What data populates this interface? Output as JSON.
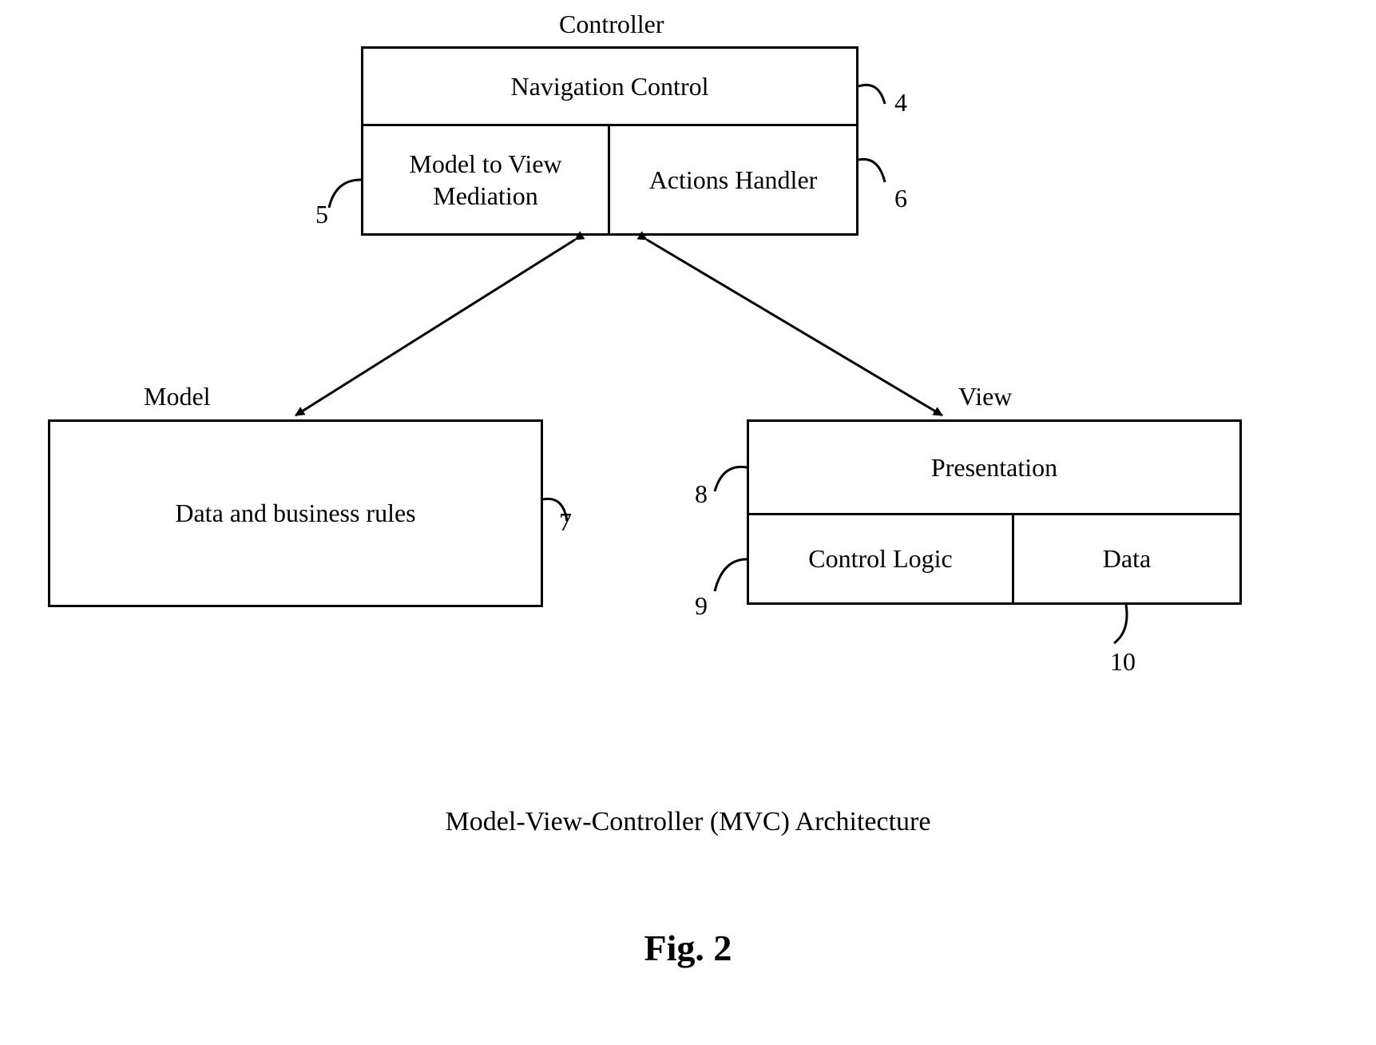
{
  "diagram": {
    "title_caption": "Model-View-Controller (MVC) Architecture",
    "figure_label": "Fig. 2",
    "controller": {
      "label": "Controller",
      "nav_control": "Navigation Control",
      "model_to_view_mediation": "Model to View\nMediation",
      "actions_handler": "Actions Handler"
    },
    "model": {
      "label": "Model",
      "data_and_business_rules": "Data and business rules"
    },
    "view": {
      "label": "View",
      "presentation": "Presentation",
      "control_logic": "Control Logic",
      "data": "Data"
    },
    "refs": {
      "r4": "4",
      "r5": "5",
      "r6": "6",
      "r7": "7",
      "r8": "8",
      "r9": "9",
      "r10": "10"
    }
  }
}
